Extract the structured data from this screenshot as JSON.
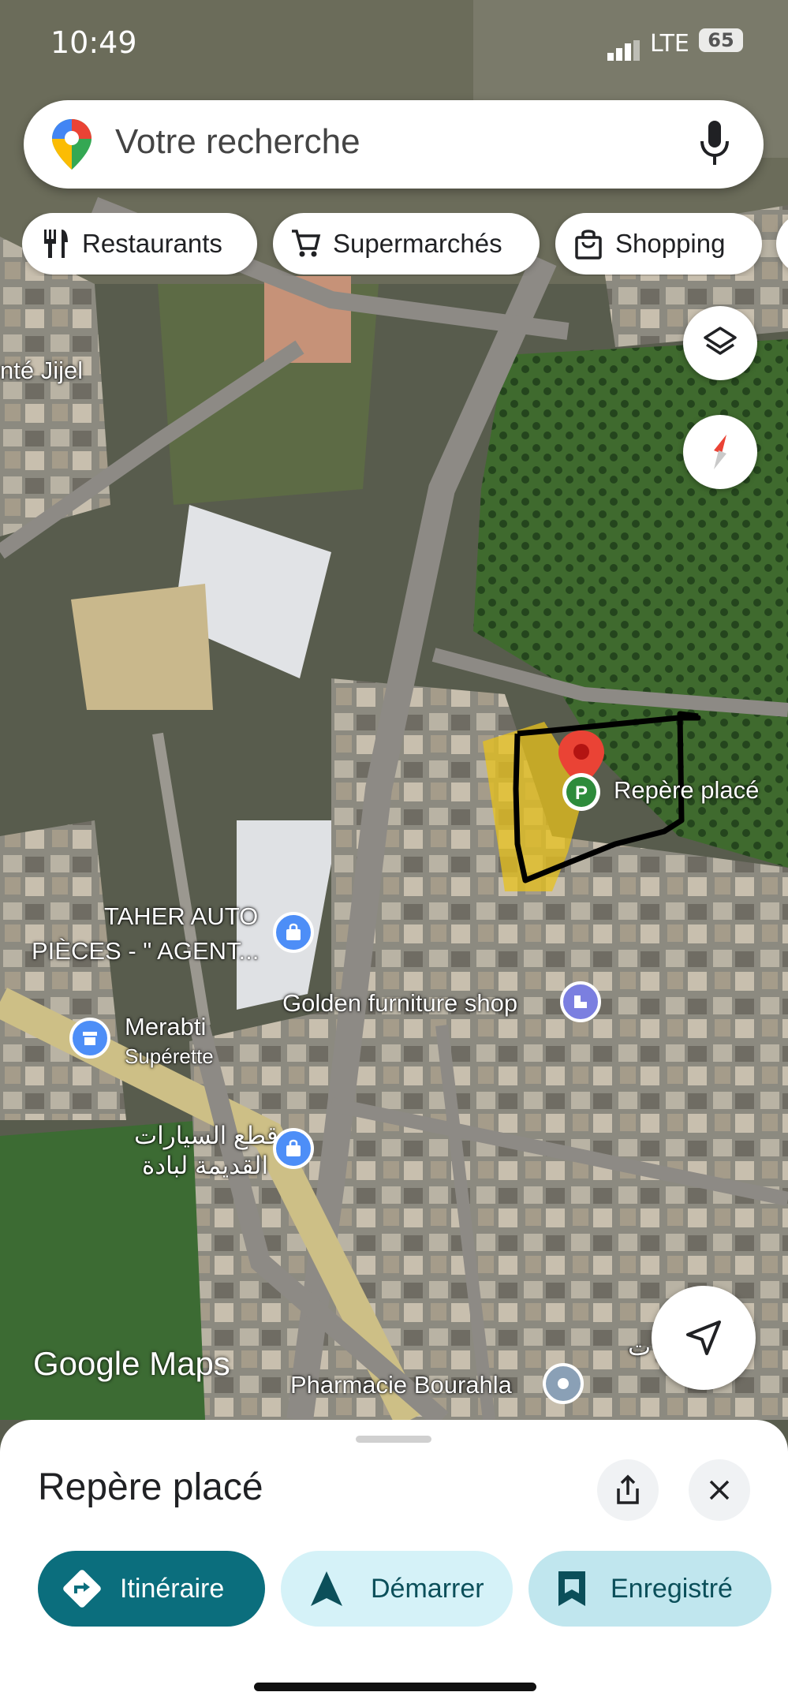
{
  "status_bar": {
    "time": "10:49",
    "network": "LTE",
    "battery": "65"
  },
  "search": {
    "placeholder": "Votre recherche"
  },
  "chips": [
    {
      "label": "Restaurants",
      "icon": "cutlery-icon"
    },
    {
      "label": "Supermarchés",
      "icon": "cart-icon"
    },
    {
      "label": "Shopping",
      "icon": "shopping-bag-icon"
    }
  ],
  "map_labels": {
    "sante": "nté Jijel",
    "taher_line1": "TAHER AUTO",
    "taher_line2": "PIÈCES - \" AGENT...",
    "golden": "Golden furniture shop",
    "merabti": "Merabti",
    "merabti_sub": "Supérette",
    "arabic_line1": "قطع السيارات",
    "arabic_line2": "القديمة لبادة",
    "pharmacie": "Pharmacie Bourahla",
    "pin_label": "Repère placé",
    "arabic_right": "قطع غيار ت"
  },
  "brand": "Google Maps",
  "sheet": {
    "title": "Repère placé",
    "actions": [
      {
        "label": "Itinéraire",
        "icon": "directions-icon"
      },
      {
        "label": "Démarrer",
        "icon": "navigation-arrow-icon"
      },
      {
        "label": "Enregistré",
        "icon": "bookmark-icon"
      }
    ]
  },
  "colors": {
    "primary_teal": "#0b6e7d",
    "light_teal": "#d5f2f8",
    "mid_teal": "#c0e6ee",
    "pin_red": "#ea4335",
    "highlight_yellow": "#e8c21c",
    "poi_blue": "#4d8ef7"
  }
}
